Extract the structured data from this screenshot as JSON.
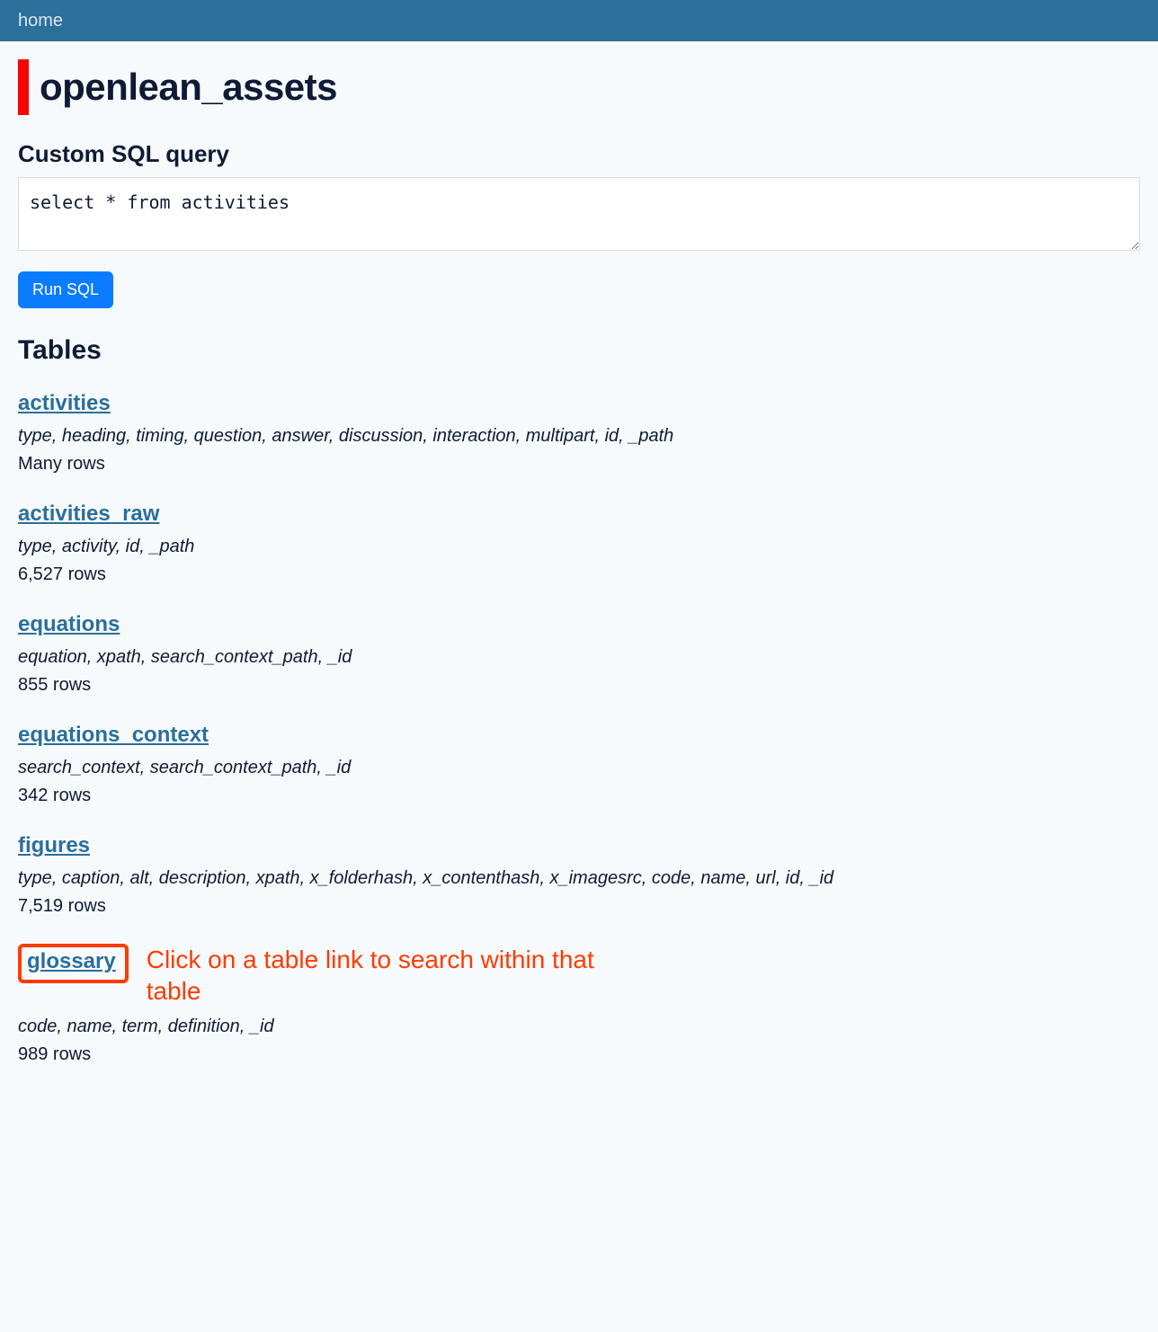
{
  "nav": {
    "home": "home"
  },
  "header": {
    "title": "openlean_assets"
  },
  "sql": {
    "heading": "Custom SQL query",
    "query": "select * from activities",
    "run_label": "Run SQL"
  },
  "tables_heading": "Tables",
  "tables": [
    {
      "name": "activities",
      "columns": "type, heading, timing, question, answer, discussion, interaction, multipart, id, _path",
      "rows": "Many rows",
      "highlight": false
    },
    {
      "name": "activities_raw",
      "columns": "type, activity, id, _path",
      "rows": "6,527 rows",
      "highlight": false
    },
    {
      "name": "equations",
      "columns": "equation, xpath, search_context_path, _id",
      "rows": "855 rows",
      "highlight": false
    },
    {
      "name": "equations_context",
      "columns": "search_context, search_context_path, _id",
      "rows": "342 rows",
      "highlight": false
    },
    {
      "name": "figures",
      "columns": "type, caption, alt, description, xpath, x_folderhash, x_contenthash, x_imagesrc, code, name, url, id, _id",
      "rows": "7,519 rows",
      "highlight": false
    },
    {
      "name": "glossary",
      "columns": "code, name, term, definition, _id",
      "rows": "989 rows",
      "highlight": true
    }
  ],
  "annotation": "Click on a table link to search within that table"
}
